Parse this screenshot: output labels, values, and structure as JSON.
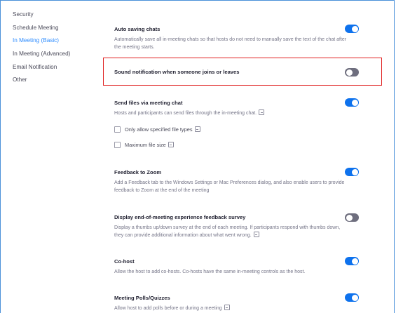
{
  "sidebar": {
    "items": [
      {
        "label": "Security",
        "active": false
      },
      {
        "label": "Schedule Meeting",
        "active": false
      },
      {
        "label": "In Meeting (Basic)",
        "active": true
      },
      {
        "label": "In Meeting (Advanced)",
        "active": false
      },
      {
        "label": "Email Notification",
        "active": false
      },
      {
        "label": "Other",
        "active": false
      }
    ]
  },
  "settings": {
    "auto_saving_chats": {
      "title": "Auto saving chats",
      "description": "Automatically save all in-meeting chats so that hosts do not need to manually save the text of the chat after the meeting starts.",
      "enabled": true
    },
    "sound_notification": {
      "title": "Sound notification when someone joins or leaves",
      "enabled": false
    },
    "send_files": {
      "title": "Send files via meeting chat",
      "description": "Hosts and participants can send files through the in-meeting chat.",
      "enabled": true,
      "options": [
        {
          "label": "Only allow specified file types",
          "checked": false
        },
        {
          "label": "Maximum file size",
          "checked": false
        }
      ]
    },
    "feedback_to_zoom": {
      "title": "Feedback to Zoom",
      "description": "Add a Feedback tab to the Windows Settings or Mac Preferences dialog, and also enable users to provide feedback to Zoom at the end of the meeting",
      "enabled": true
    },
    "end_of_meeting_survey": {
      "title": "Display end-of-meeting experience feedback survey",
      "description": "Display a thumbs up/down survey at the end of each meeting. If participants respond with thumbs down, they can provide additional information about what went wrong.",
      "enabled": false
    },
    "co_host": {
      "title": "Co-host",
      "description": "Allow the host to add co-hosts. Co-hosts have the same in-meeting controls as the host.",
      "enabled": true
    },
    "meeting_polls": {
      "title": "Meeting Polls/Quizzes",
      "description": "Allow host to add polls before or during a meeting",
      "enabled": true
    }
  },
  "colors": {
    "accent": "#0e72ed",
    "toggle_off": "#6e6e7e",
    "highlight_border": "#e02020",
    "active_nav": "#2d8cff"
  }
}
